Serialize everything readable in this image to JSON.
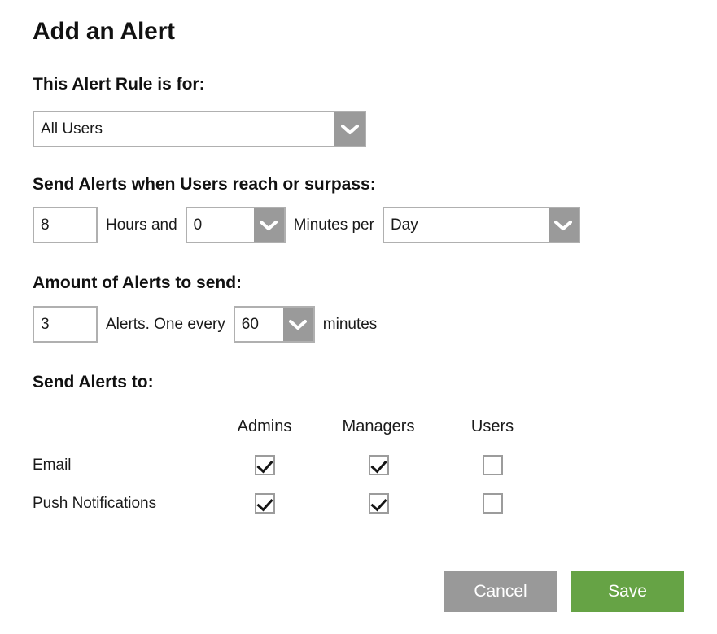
{
  "title": "Add an Alert",
  "sections": {
    "rule_for": {
      "label": "This Alert Rule is for:",
      "select_value": "All Users",
      "chevron_icon": "chevron-down-icon"
    },
    "threshold": {
      "label": "Send Alerts when Users reach or surpass:",
      "hours_value": "8",
      "hours_text": "Hours and",
      "minutes_value": "0",
      "minutes_text": "Minutes per",
      "period_value": "Day"
    },
    "amount": {
      "label": "Amount of Alerts to send:",
      "alerts_value": "3",
      "alerts_text": "Alerts. One every",
      "interval_value": "60",
      "interval_text": "minutes"
    },
    "send_to": {
      "label": "Send Alerts to:",
      "columns": [
        "Admins",
        "Managers",
        "Users"
      ],
      "rows": [
        {
          "label": "Email",
          "checked": [
            true,
            true,
            false
          ]
        },
        {
          "label": "Push Notifications",
          "checked": [
            true,
            true,
            false
          ]
        }
      ]
    }
  },
  "actions": {
    "cancel_label": "Cancel",
    "save_label": "Save"
  },
  "colors": {
    "save_green": "#66a345",
    "cancel_gray": "#999999",
    "dropdown_button_gray": "#9a9a9a",
    "field_border": "#b0b0b0",
    "background": "#ffffff"
  }
}
